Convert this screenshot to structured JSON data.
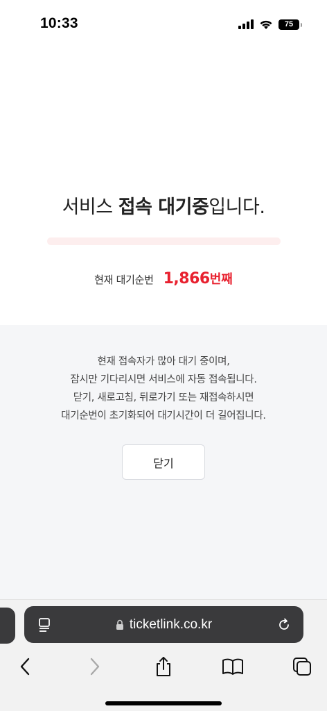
{
  "status_bar": {
    "time": "10:33",
    "battery": "75"
  },
  "waiting": {
    "headline_pre": "서비스 ",
    "headline_bold": "접속 대기중",
    "headline_post": "입니다.",
    "progress_percent": 0,
    "queue_label": "현재 대기순번",
    "queue_number": "1,866",
    "queue_suffix": "번째",
    "accent_color": "#e8212f"
  },
  "info": {
    "line1": "현재 접속자가 많아 대기 중이며,",
    "line2": "잠시만 기다리시면 서비스에 자동 접속됩니다.",
    "line3": "닫기, 새로고침, 뒤로가기 또는 재접속하시면",
    "line4": "대기순번이 초기화되어 대기시간이 더 길어집니다.",
    "close_label": "닫기"
  },
  "browser": {
    "url": "ticketlink.co.kr",
    "icons": [
      "reader-icon",
      "lock-icon",
      "reload-icon",
      "back-icon",
      "forward-icon",
      "share-icon",
      "bookmarks-icon",
      "tabs-icon"
    ]
  }
}
